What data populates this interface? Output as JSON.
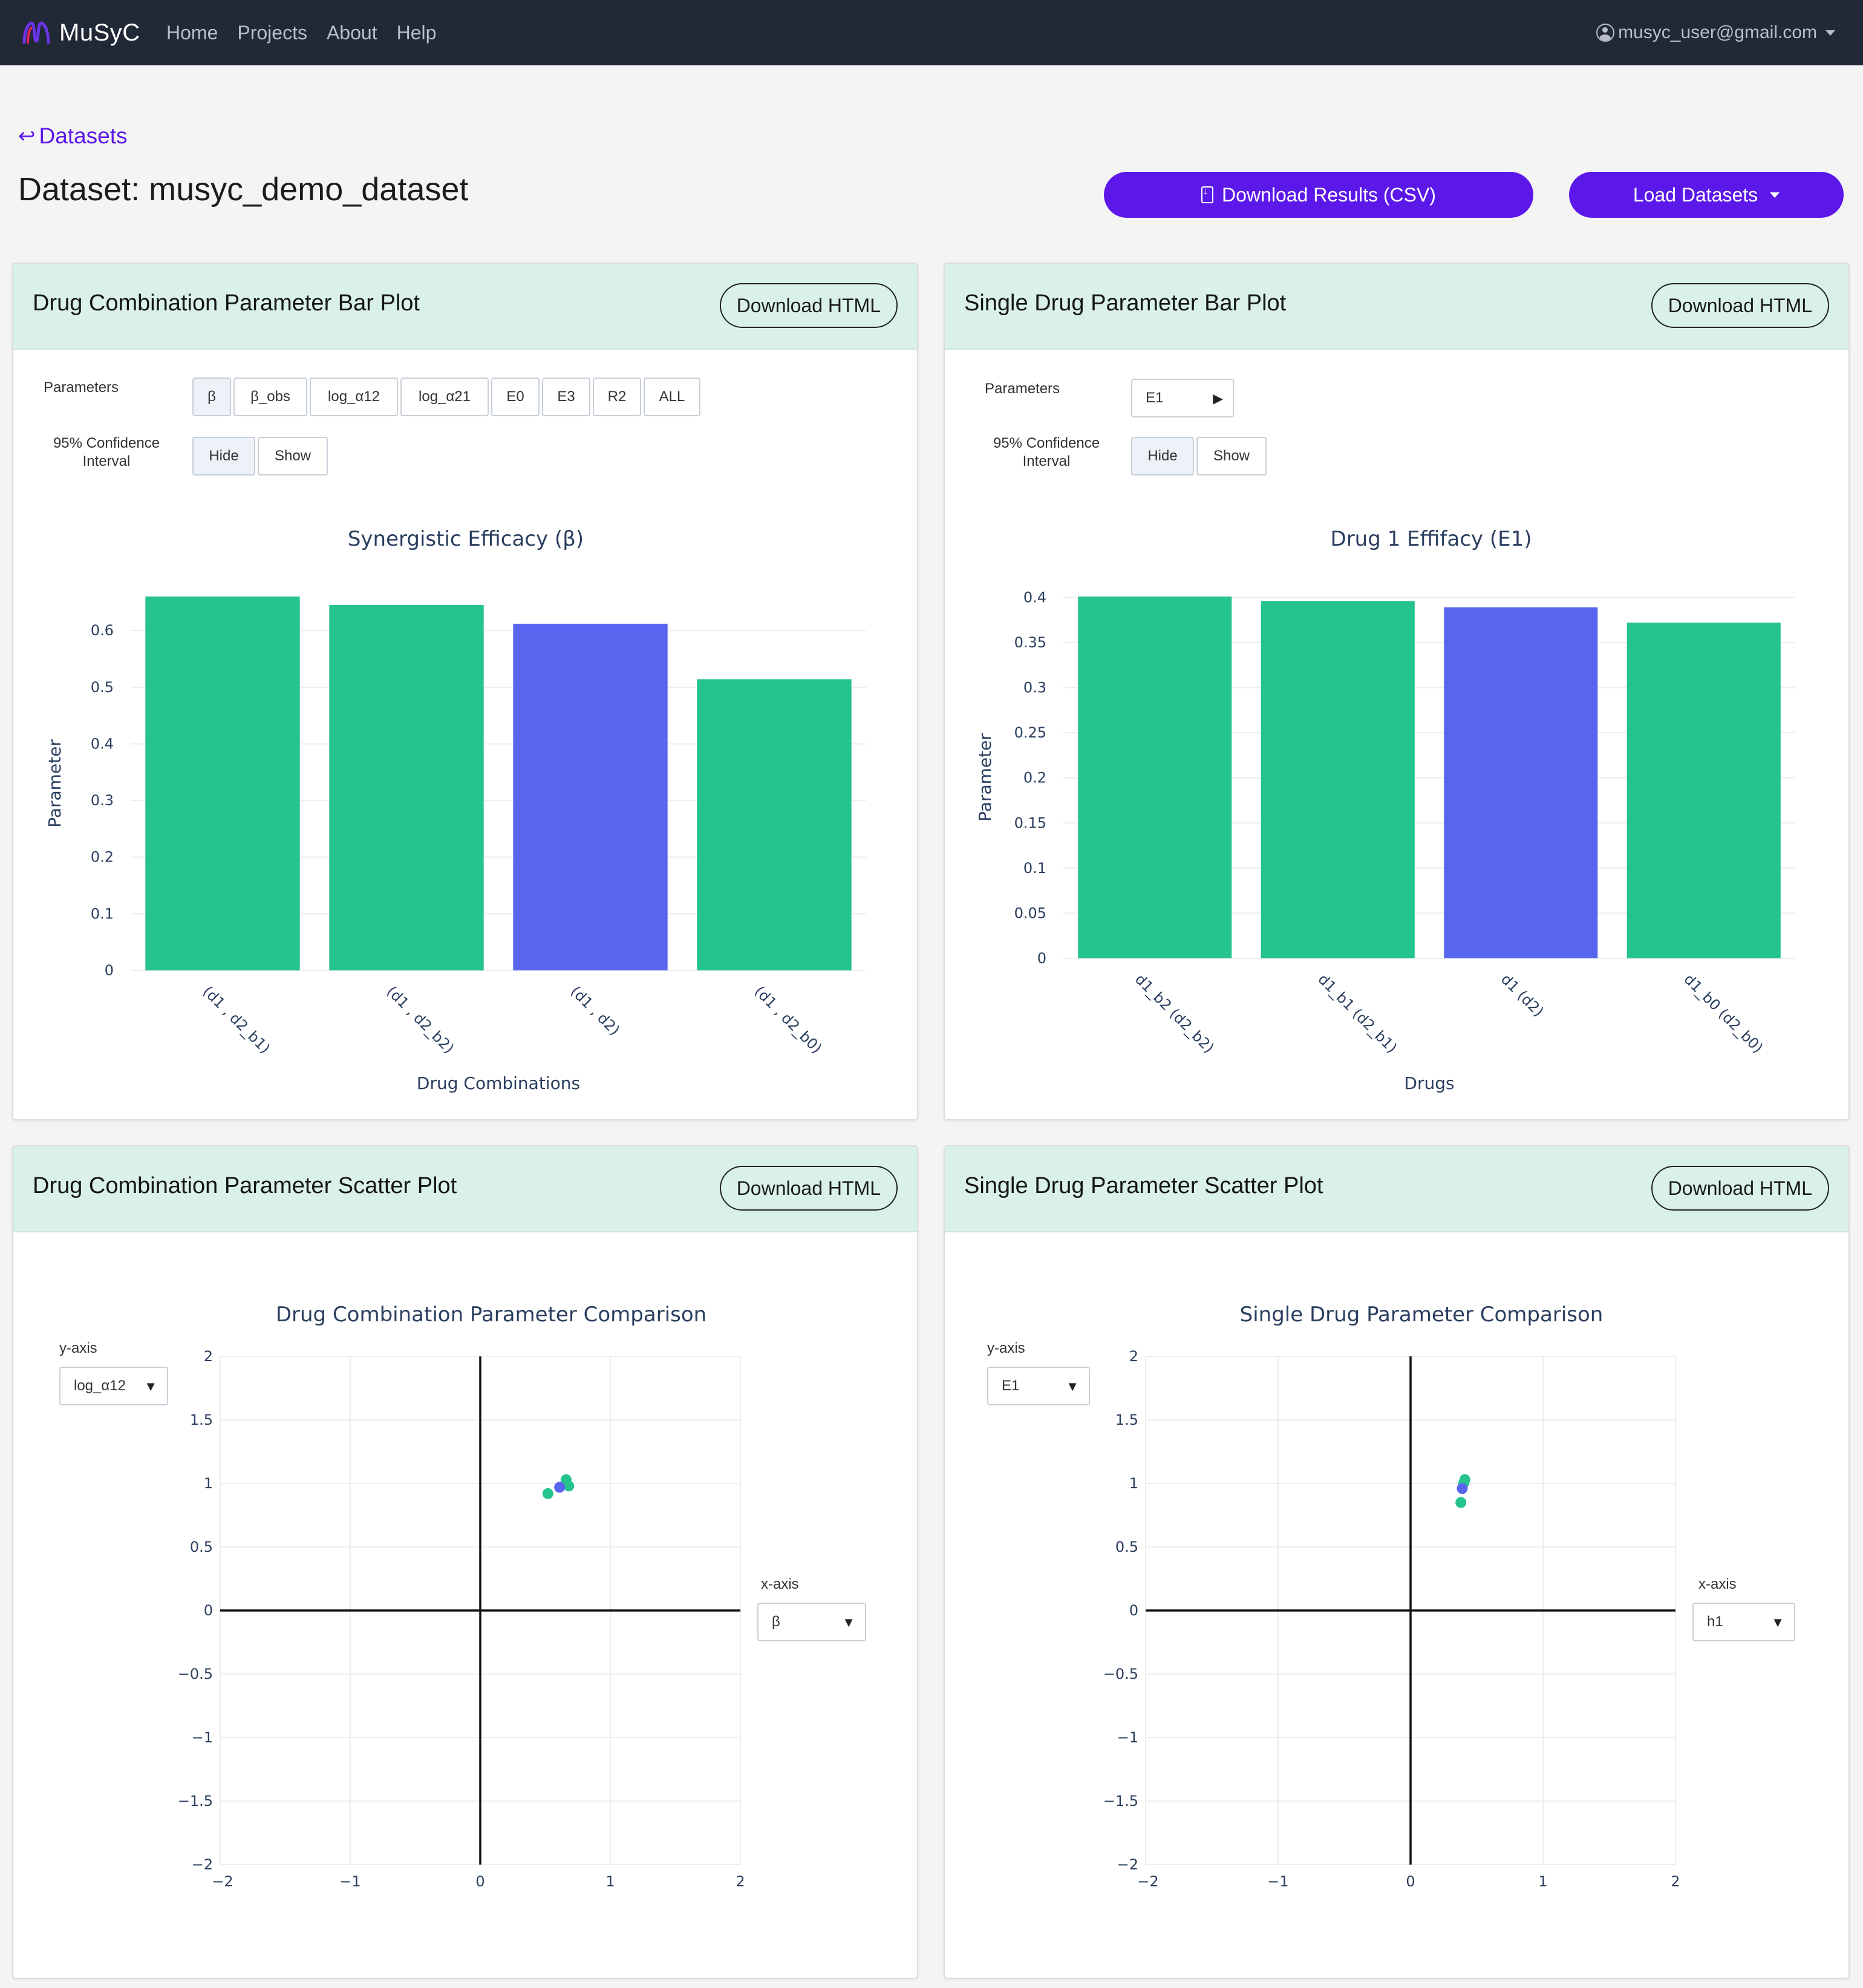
{
  "nav": {
    "brand": "MuSyC",
    "links": [
      "Home",
      "Projects",
      "About",
      "Help"
    ],
    "user": "musyc_user@gmail.com"
  },
  "header": {
    "back_label": "Datasets",
    "title": "Dataset: musyc_demo_dataset",
    "download_label": "Download Results (CSV)",
    "load_label": "Load Datasets"
  },
  "colors": {
    "accent": "#5b18e8",
    "bar_green": "#24c48c",
    "bar_highlight": "#5865ef",
    "header_bg": "#d9f1ea"
  },
  "combo_bar": {
    "title": "Drug Combination Parameter Bar Plot",
    "download_label": "Download HTML",
    "params_label": "Parameters",
    "params": [
      "β",
      "β_obs",
      "log_α12",
      "log_α21",
      "E0",
      "E3",
      "R2",
      "ALL"
    ],
    "ci_label": "95% Confidence Interval",
    "ci_options": [
      "Hide",
      "Show"
    ]
  },
  "single_bar": {
    "title": "Single Drug Parameter Bar Plot",
    "download_label": "Download HTML",
    "params_label": "Parameters",
    "param_selected": "E1",
    "ci_label": "95% Confidence Interval",
    "ci_options": [
      "Hide",
      "Show"
    ]
  },
  "combo_scatter": {
    "title": "Drug Combination Parameter Scatter Plot",
    "download_label": "Download HTML",
    "y_axis_label": "y-axis",
    "y_axis_value": "log_α12",
    "x_axis_label": "x-axis",
    "x_axis_value": "β"
  },
  "single_scatter": {
    "title": "Single Drug Parameter Scatter Plot",
    "download_label": "Download HTML",
    "y_axis_label": "y-axis",
    "y_axis_value": "E1",
    "x_axis_label": "x-axis",
    "x_axis_value": "h1"
  },
  "chart_data": [
    {
      "type": "bar",
      "title": "Synergistic Efficacy (β)",
      "xlabel": "Drug Combinations",
      "ylabel": "Parameter",
      "categories": [
        "(d1 , d2_b1)",
        "(d1 , d2_b2)",
        "(d1 , d2)",
        "(d1 , d2_b0)"
      ],
      "values": [
        0.66,
        0.645,
        0.612,
        0.514
      ],
      "highlight_index": 2,
      "ylim": [
        0,
        0.66
      ],
      "yticks": [
        0,
        0.1,
        0.2,
        0.3,
        0.4,
        0.5,
        0.6
      ],
      "ytick_labels": [
        "0",
        "0.1",
        "0.2",
        "0.3",
        "0.4",
        "0.5",
        "0.6"
      ]
    },
    {
      "type": "bar",
      "title": "Drug 1 Effifacy (E1)",
      "xlabel": "Drugs",
      "ylabel": "Parameter",
      "categories": [
        "d1_b2 (d2_b2)",
        "d1_b1 (d2_b1)",
        "d1 (d2)",
        "d1_b0 (d2_b0)"
      ],
      "values": [
        0.401,
        0.396,
        0.389,
        0.372
      ],
      "highlight_index": 2,
      "ylim": [
        0,
        0.401
      ],
      "yticks": [
        0,
        0.05,
        0.1,
        0.15,
        0.2,
        0.25,
        0.3,
        0.35,
        0.4
      ],
      "ytick_labels": [
        "0",
        "0.05",
        "0.1",
        "0.15",
        "0.2",
        "0.25",
        "0.3",
        "0.35",
        "0.4"
      ]
    },
    {
      "type": "scatter",
      "title": "Drug Combination Parameter Comparison",
      "xlim": [
        -2,
        2
      ],
      "ylim": [
        -2,
        2
      ],
      "xticks": [
        -2,
        -1,
        0,
        1,
        2
      ],
      "xtick_labels": [
        "−2",
        "−1",
        "0",
        "1",
        "2"
      ],
      "yticks": [
        -2,
        -1.5,
        -1,
        -0.5,
        0,
        0.5,
        1,
        1.5,
        2
      ],
      "ytick_labels": [
        "−2",
        "−1.5",
        "−1",
        "−0.5",
        "0",
        "0.5",
        "1",
        "1.5",
        "2"
      ],
      "points": [
        {
          "x": 0.52,
          "y": 0.92,
          "highlight": false
        },
        {
          "x": 0.66,
          "y": 1.03,
          "highlight": false
        },
        {
          "x": 0.68,
          "y": 0.98,
          "highlight": false
        },
        {
          "x": 0.61,
          "y": 0.97,
          "highlight": true
        }
      ]
    },
    {
      "type": "scatter",
      "title": "Single Drug Parameter Comparison",
      "xlim": [
        -2,
        2
      ],
      "ylim": [
        -2,
        2
      ],
      "xticks": [
        -2,
        -1,
        0,
        1,
        2
      ],
      "xtick_labels": [
        "−2",
        "−1",
        "0",
        "1",
        "2"
      ],
      "yticks": [
        -2,
        -1.5,
        -1,
        -0.5,
        0,
        0.5,
        1,
        1.5,
        2
      ],
      "ytick_labels": [
        "−2",
        "−1.5",
        "−1",
        "−0.5",
        "0",
        "0.5",
        "1",
        "1.5",
        "2"
      ],
      "points": [
        {
          "x": 0.38,
          "y": 0.85,
          "highlight": false
        },
        {
          "x": 0.41,
          "y": 1.03,
          "highlight": false
        },
        {
          "x": 0.4,
          "y": 1.0,
          "highlight": false
        },
        {
          "x": 0.39,
          "y": 0.96,
          "highlight": true
        }
      ]
    }
  ]
}
